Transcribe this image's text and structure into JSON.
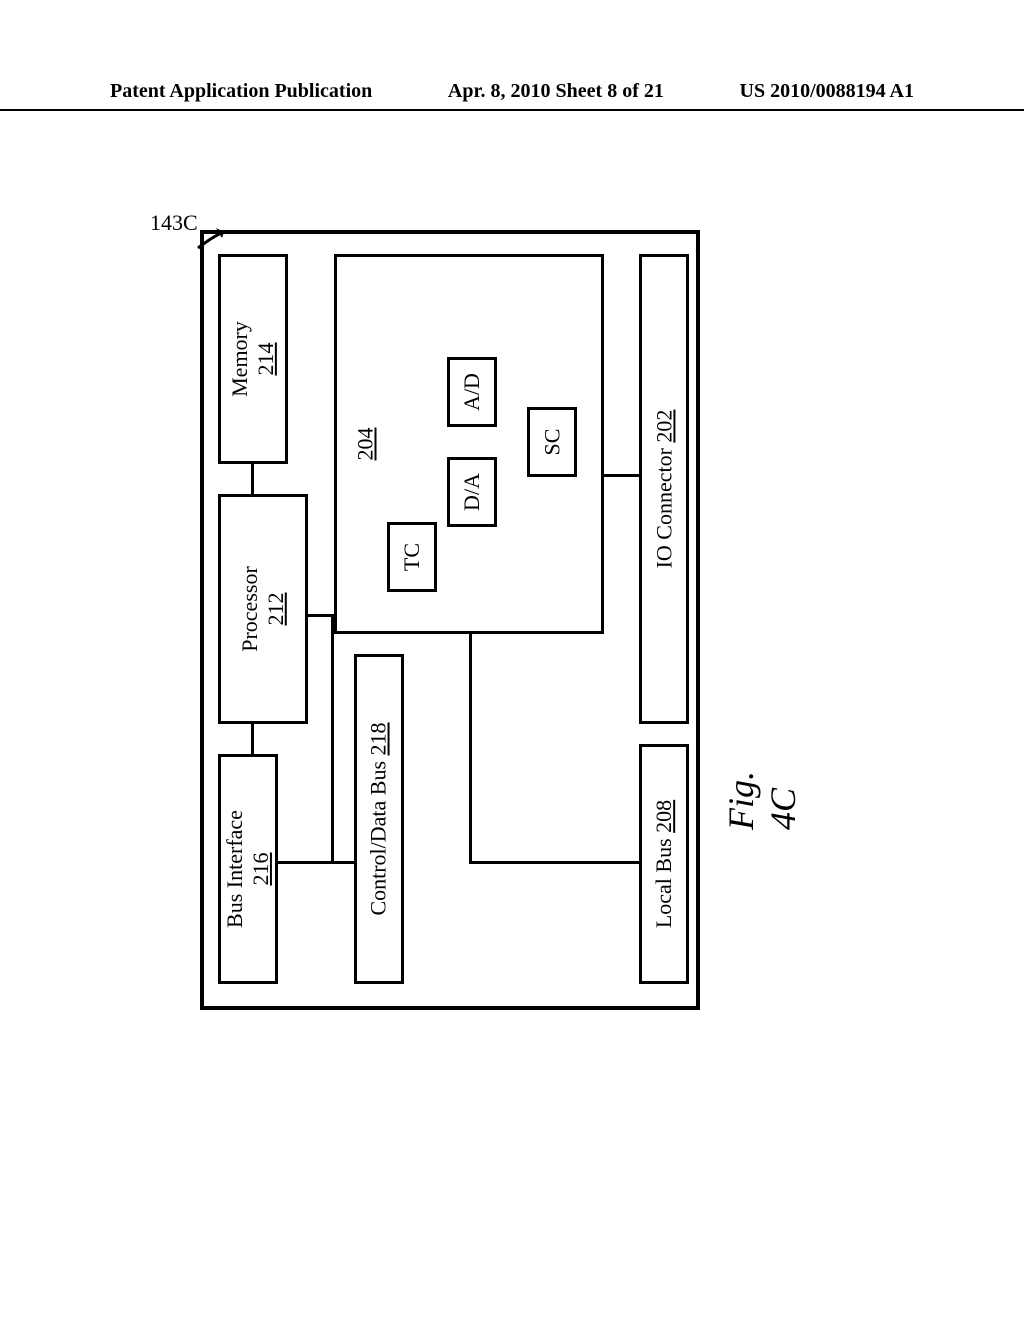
{
  "header": {
    "left": "Patent Application Publication",
    "middle": "Apr. 8, 2010  Sheet 8 of 21",
    "right": "US 2010/0088194 A1"
  },
  "ref": "143C",
  "figure_label": "Fig. 4C",
  "blocks": {
    "io_connector": {
      "label": "IO Connector",
      "num": "202"
    },
    "submodule": {
      "num": "204",
      "sc": "SC",
      "ad": "A/D",
      "da": "D/A",
      "tc": "TC"
    },
    "local_bus": {
      "label": "Local Bus",
      "num": "208"
    },
    "control_bus": {
      "label": "Control/Data Bus",
      "num": "218"
    },
    "memory": {
      "label": "Memory",
      "num": "214"
    },
    "processor": {
      "label": "Processor",
      "num": "212"
    },
    "bus_if": {
      "label": "Bus Interface",
      "num": "216"
    }
  }
}
